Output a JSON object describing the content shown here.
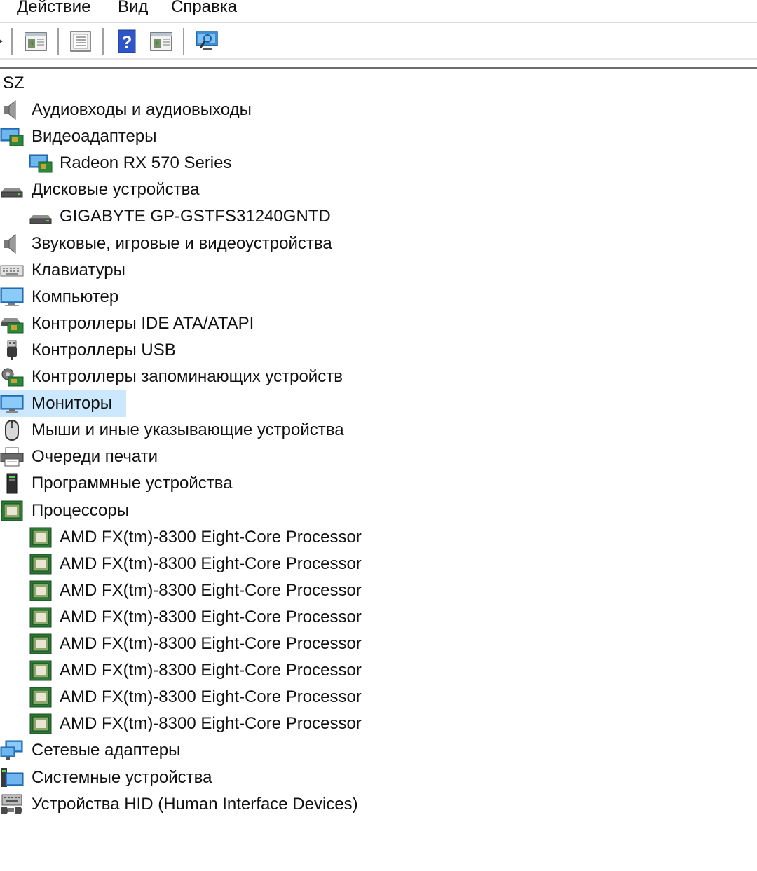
{
  "menu": {
    "action": "Действие",
    "view": "Вид",
    "help": "Справка"
  },
  "toolbar": {
    "icons": [
      "back-icon",
      "properties-icon",
      "list-icon",
      "help-icon",
      "run-icon",
      "monitor-scan-icon"
    ]
  },
  "tree": {
    "root": "SZ",
    "items": [
      {
        "label": "Аудиовходы и аудиовыходы",
        "icon": "speaker-icon",
        "level": 1
      },
      {
        "label": "Видеоадаптеры",
        "icon": "display-adapter-icon",
        "level": 1
      },
      {
        "label": "Radeon RX 570 Series",
        "icon": "display-adapter-icon",
        "level": 2
      },
      {
        "label": "Дисковые устройства",
        "icon": "disk-drive-icon",
        "level": 1
      },
      {
        "label": "GIGABYTE GP-GSTFS31240GNTD",
        "icon": "disk-drive-icon",
        "level": 2
      },
      {
        "label": "Звуковые, игровые и видеоустройства",
        "icon": "speaker-icon",
        "level": 1
      },
      {
        "label": "Клавиатуры",
        "icon": "keyboard-icon",
        "level": 1
      },
      {
        "label": "Компьютер",
        "icon": "computer-icon",
        "level": 1
      },
      {
        "label": "Контроллеры IDE ATA/ATAPI",
        "icon": "ide-controller-icon",
        "level": 1
      },
      {
        "label": "Контроллеры USB",
        "icon": "usb-icon",
        "level": 1
      },
      {
        "label": "Контроллеры запоминающих устройств",
        "icon": "storage-controller-icon",
        "level": 1
      },
      {
        "label": "Мониторы",
        "icon": "monitor-icon",
        "level": 1,
        "selected": true
      },
      {
        "label": "Мыши и иные указывающие устройства",
        "icon": "mouse-icon",
        "level": 1
      },
      {
        "label": "Очереди печати",
        "icon": "printer-icon",
        "level": 1
      },
      {
        "label": "Программные устройства",
        "icon": "software-device-icon",
        "level": 1
      },
      {
        "label": "Процессоры",
        "icon": "processor-icon",
        "level": 1
      },
      {
        "label": "AMD FX(tm)-8300 Eight-Core Processor",
        "icon": "processor-icon",
        "level": 2
      },
      {
        "label": "AMD FX(tm)-8300 Eight-Core Processor",
        "icon": "processor-icon",
        "level": 2
      },
      {
        "label": "AMD FX(tm)-8300 Eight-Core Processor",
        "icon": "processor-icon",
        "level": 2
      },
      {
        "label": "AMD FX(tm)-8300 Eight-Core Processor",
        "icon": "processor-icon",
        "level": 2
      },
      {
        "label": "AMD FX(tm)-8300 Eight-Core Processor",
        "icon": "processor-icon",
        "level": 2
      },
      {
        "label": "AMD FX(tm)-8300 Eight-Core Processor",
        "icon": "processor-icon",
        "level": 2
      },
      {
        "label": "AMD FX(tm)-8300 Eight-Core Processor",
        "icon": "processor-icon",
        "level": 2
      },
      {
        "label": "AMD FX(tm)-8300 Eight-Core Processor",
        "icon": "processor-icon",
        "level": 2
      },
      {
        "label": "Сетевые адаптеры",
        "icon": "network-adapter-icon",
        "level": 1
      },
      {
        "label": "Системные устройства",
        "icon": "system-devices-icon",
        "level": 1
      },
      {
        "label": "Устройства HID (Human Interface Devices)",
        "icon": "hid-icon",
        "level": 1
      }
    ]
  },
  "colors": {
    "selection": "#cce8ff",
    "text": "#111111",
    "separator": "#a0a0a0"
  }
}
